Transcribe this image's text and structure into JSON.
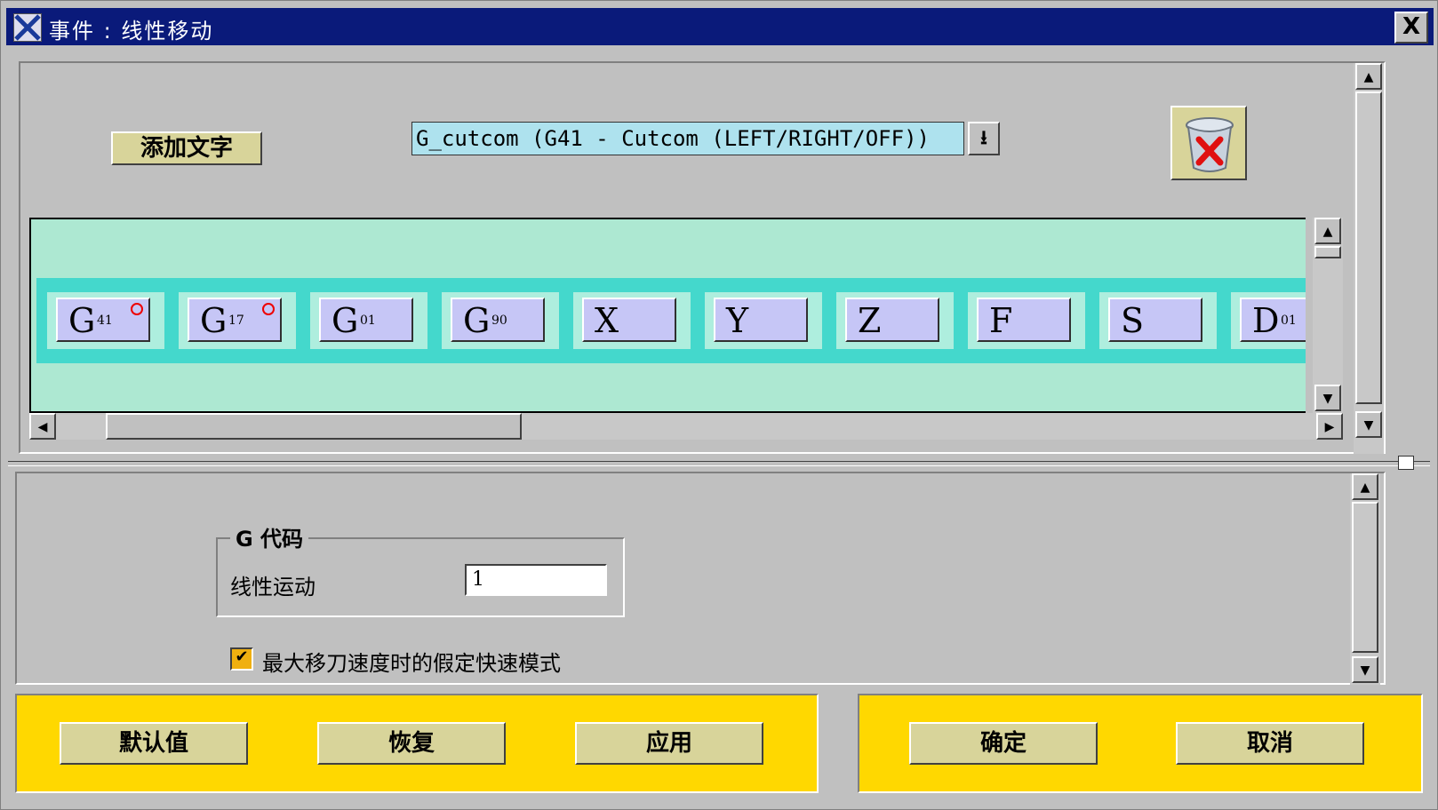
{
  "window": {
    "title": "事件 : 线性移动",
    "close_glyph": "X"
  },
  "toolbar": {
    "add_text_label": "添加文字",
    "combo_value": "G_cutcom (G41 - Cutcom (LEFT/RIGHT/OFF))",
    "combo_arrow": "⭳",
    "trash_icon": "trash-delete-icon"
  },
  "tokens": [
    {
      "main": "G",
      "sub": "41",
      "marked": true
    },
    {
      "main": "G",
      "sub": "17",
      "marked": true
    },
    {
      "main": "G",
      "sub": "01",
      "marked": false
    },
    {
      "main": "G",
      "sub": "90",
      "marked": false
    },
    {
      "main": "X",
      "sub": "",
      "marked": false
    },
    {
      "main": "Y",
      "sub": "",
      "marked": false
    },
    {
      "main": "Z",
      "sub": "",
      "marked": false
    },
    {
      "main": "F",
      "sub": "",
      "marked": false
    },
    {
      "main": "S",
      "sub": "",
      "marked": false
    },
    {
      "main": "D",
      "sub": "01",
      "marked": true
    }
  ],
  "gcode_group": {
    "title": "G 代码",
    "linear_label": "线性运动",
    "linear_value": "1"
  },
  "rapid_option": {
    "label": "最大移刀速度时的假定快速模式",
    "checked": true
  },
  "buttons": {
    "default": "默认值",
    "restore": "恢复",
    "apply": "应用",
    "ok": "确定",
    "cancel": "取消"
  },
  "colors": {
    "title_bar": "#0a1a7a",
    "band": "#ade8d2",
    "strip": "#44d8cc",
    "token": "#c6c6f6",
    "button_bar": "#ffd800",
    "button": "#d8d49a"
  }
}
